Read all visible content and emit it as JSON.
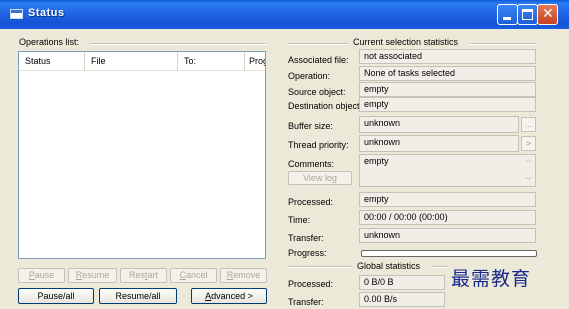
{
  "window": {
    "title": "Status"
  },
  "left": {
    "operations_label": "Operations list:",
    "columns": [
      "Status",
      "File",
      "To:",
      "Prog..."
    ],
    "buttons": {
      "pause": "Pause",
      "resume": "Resume",
      "restart": "Restart",
      "cancel": "Cancel",
      "remove": "Remove",
      "pause_all": "Pause/all",
      "resume_all": "Resume/all",
      "advanced": "Advanced >"
    }
  },
  "right": {
    "current_heading": "Current selection statistics",
    "associated_file": {
      "label": "Associated file:",
      "value": "not associated"
    },
    "operation": {
      "label": "Operation:",
      "value": "None of tasks selected"
    },
    "source": {
      "label": "Source object:",
      "value": "empty"
    },
    "destination": {
      "label": "Destination object:",
      "value": "empty"
    },
    "buffer_size": {
      "label": "Buffer size:",
      "value": "unknown"
    },
    "thread_priority": {
      "label": "Thread priority:",
      "value": "unknown"
    },
    "comments": {
      "label": "Comments:",
      "value": "empty"
    },
    "view_log": "View log",
    "processed": {
      "label": "Processed:",
      "value": "empty"
    },
    "time": {
      "label": "Time:",
      "value": "00:00 / 00:00 (00:00)"
    },
    "transfer": {
      "label": "Transfer:",
      "value": "unknown"
    },
    "progress": {
      "label": "Progress:",
      "value": 0
    },
    "global_heading": "Global statistics",
    "global_processed": {
      "label": "Processed:",
      "value": "0 B/0 B"
    },
    "global_transfer": {
      "label": "Transfer:",
      "value": "0.00 B/s"
    }
  },
  "watermark": "最需教育"
}
